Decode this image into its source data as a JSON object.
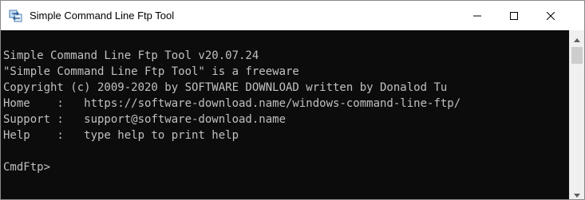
{
  "window": {
    "title": "Simple Command Line Ftp Tool"
  },
  "console": {
    "lines": [
      "Simple Command Line Ftp Tool v20.07.24",
      "\"Simple Command Line Ftp Tool\" is a freeware",
      "Copyright (c) 2009-2020 by SOFTWARE DOWNLOAD written by Donalod Tu",
      "Home    :   https://software-download.name/windows-command-line-ftp/",
      "Support :   support@software-download.name",
      "Help    :   type help to print help"
    ],
    "prompt": "CmdFtp>"
  },
  "icons": {
    "app": "ftp-app-icon",
    "minimize": "minimize-icon",
    "maximize": "maximize-icon",
    "close": "close-icon",
    "scroll_up": "scroll-up-arrow-icon",
    "scroll_down": "scroll-down-arrow-icon"
  },
  "colors": {
    "console_bg": "#0c0c0c",
    "console_fg": "#c0c0c0",
    "titlebar_bg": "#ffffff"
  }
}
